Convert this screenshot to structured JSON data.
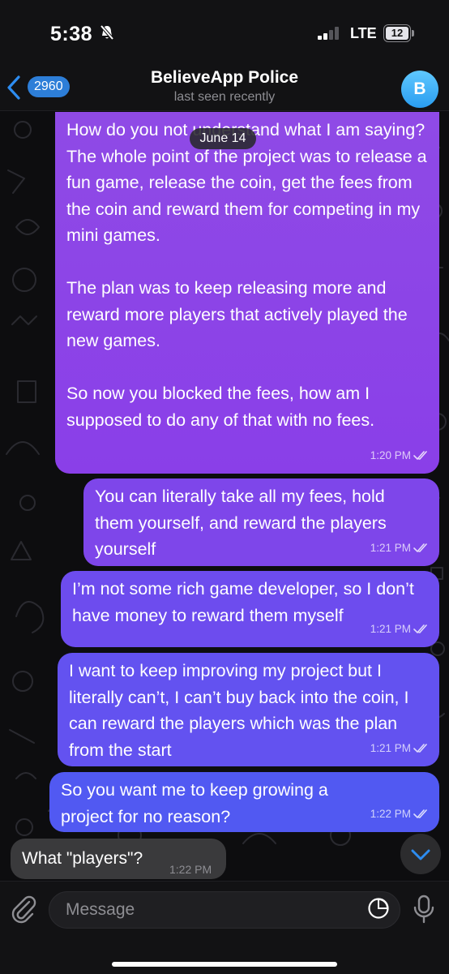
{
  "status_bar": {
    "time": "5:38",
    "network": "LTE",
    "battery": "12"
  },
  "header": {
    "back_count": "2960",
    "title": "BelieveApp Police",
    "subtitle": "last seen recently",
    "avatar_letter": "B"
  },
  "date_separator": "June 14",
  "messages": [
    {
      "direction": "outgoing",
      "text": "How do you not understand what I am saying? The whole point of the project was to release a fun game, release the coin, get the fees from the coin and reward them for competing in my mini games.\n\nThe plan was to keep releasing more and reward more players that actively played the new games.\n\nSo now you blocked the fees, how am I supposed to do any of that with no fees.",
      "time": "1:20 PM",
      "read": true
    },
    {
      "direction": "outgoing",
      "text": "You can literally take all my fees, hold them yourself, and reward the players yourself",
      "time": "1:21 PM",
      "read": true
    },
    {
      "direction": "outgoing",
      "text": "I’m not some rich game developer, so I don’t have money to reward them myself",
      "time": "1:21 PM",
      "read": true
    },
    {
      "direction": "outgoing",
      "text": "I want to keep improving my project but I literally can’t, I can’t buy back into the coin, I can reward the players which was the plan from the start",
      "time": "1:21 PM",
      "read": true
    },
    {
      "direction": "outgoing",
      "text": "So you want me to keep growing a project for no reason?",
      "time": "1:22 PM",
      "read": true
    },
    {
      "direction": "incoming",
      "text": "What \"players\"?",
      "time": "1:22 PM"
    }
  ],
  "input": {
    "placeholder": "Message"
  },
  "colors": {
    "accent": "#2d7ed8",
    "bubble_top": "#9b3fe6",
    "bubble_bottom": "#4f5cf2",
    "incoming": "#3a3a3c"
  }
}
